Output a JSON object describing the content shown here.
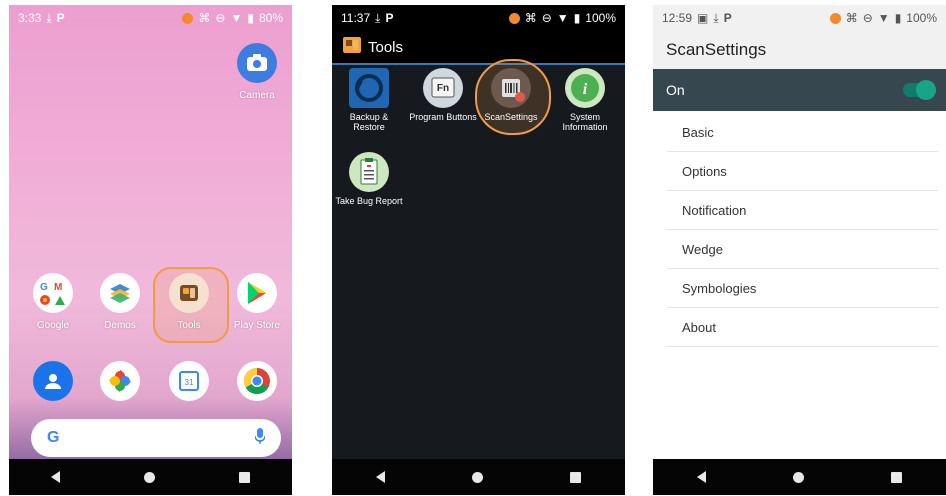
{
  "phone1": {
    "status": {
      "time": "3:33",
      "battery": "80%"
    },
    "apps_top": [
      {
        "label": "Camera"
      }
    ],
    "apps_row": [
      {
        "label": "Google"
      },
      {
        "label": "Demos"
      },
      {
        "label": "Tools"
      },
      {
        "label": "Play Store"
      }
    ],
    "search_logo": "G"
  },
  "phone2": {
    "status": {
      "time": "11:37",
      "battery": "100%"
    },
    "title": "Tools",
    "tools": [
      {
        "label": "Backup &\nRestore"
      },
      {
        "label": "Program Buttons"
      },
      {
        "label": "ScanSettings"
      },
      {
        "label": "System\nInformation"
      },
      {
        "label": "Take Bug Report"
      }
    ],
    "fn_label": "Fn"
  },
  "phone3": {
    "status": {
      "time": "12:59",
      "battery": "100%"
    },
    "title": "ScanSettings",
    "toggle_label": "On",
    "menu": [
      "Basic",
      "Options",
      "Notification",
      "Wedge",
      "Symbologies",
      "About"
    ]
  },
  "colors": {
    "highlight": "#f29a45",
    "toolbar_dark": "#37474f",
    "switch_on": "#17a589"
  }
}
